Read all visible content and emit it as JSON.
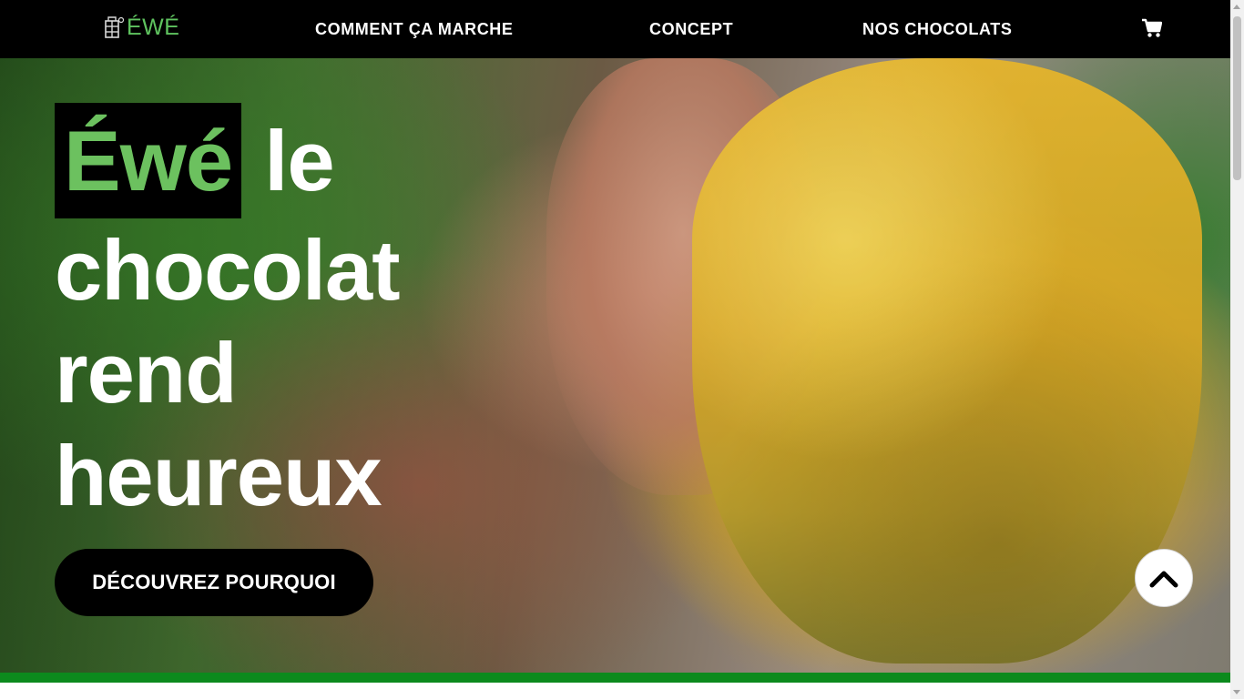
{
  "nav": {
    "brand": "ÉWÉ",
    "links": [
      "COMMENT ÇA MARCHE",
      "CONCEPT",
      "NOS CHOCOLATS"
    ],
    "cart_icon": "shopping-cart-icon"
  },
  "hero": {
    "headline_brand": "Éwé",
    "headline_line1_rest": " le",
    "headline_line2": "chocolat",
    "headline_line3": "rend",
    "headline_line4": "heureux",
    "cta_label": "DÉCOUVREZ POURQUOI",
    "image": "farmer hand holding cacao pod"
  },
  "back_to_top_icon": "chevron-up-icon",
  "colors": {
    "nav_bg": "#000000",
    "brand_green": "#6cc15f",
    "footer_bar": "#0c8a1d",
    "cta_bg": "#000000",
    "text_white": "#ffffff"
  }
}
